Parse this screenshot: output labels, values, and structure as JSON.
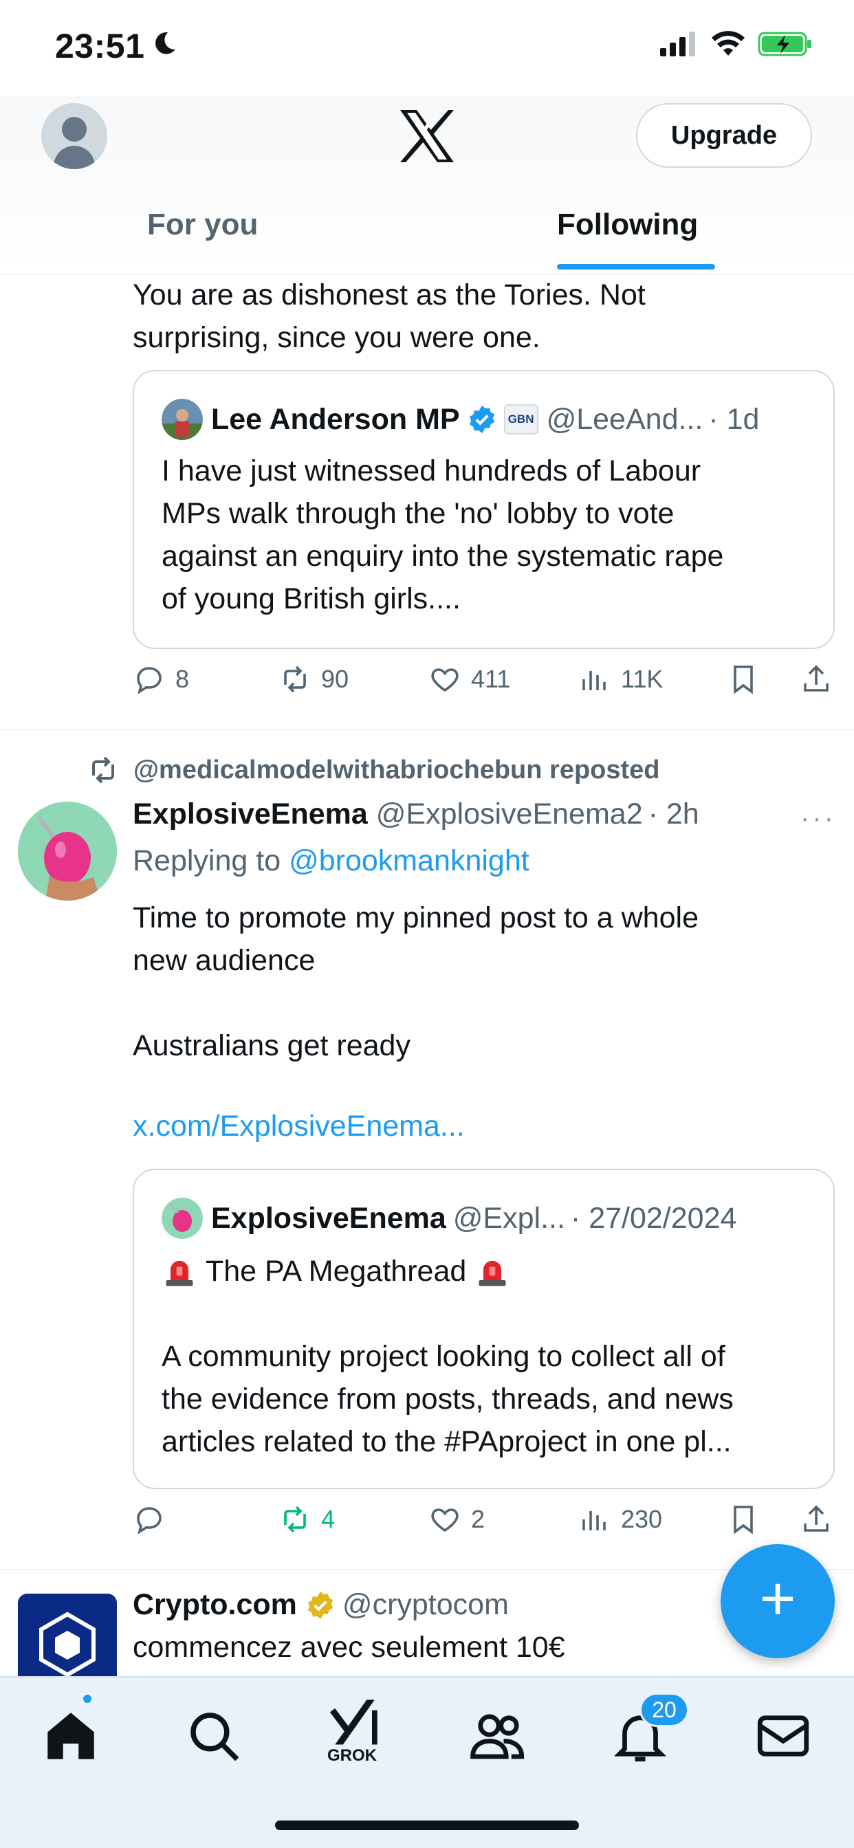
{
  "status_bar": {
    "time": "23:51"
  },
  "header": {
    "upgrade_label": "Upgrade"
  },
  "tabs": [
    {
      "label": "For you"
    },
    {
      "label": "Following"
    }
  ],
  "tweet1": {
    "text_lines": [
      "You are as dishonest as the Tories. Not",
      "surprising, since you were one."
    ],
    "quote": {
      "name": "Lee Anderson MP",
      "badge_text": "GBN",
      "handle": "@LeeAnd...",
      "time": "· 1d",
      "text_lines": [
        "I have just witnessed hundreds of Labour",
        "MPs walk through the 'no' lobby to vote",
        "against an enquiry into the systematic rape",
        "of young British girls...."
      ]
    },
    "actions": {
      "replies": "8",
      "reposts": "90",
      "likes": "411",
      "views": "11K"
    }
  },
  "tweet2": {
    "reposted_by": "@medicalmodelwithabriochebun reposted",
    "name": "ExplosiveEnema",
    "handle": "@ExplosiveEnema2",
    "time": "· 2h",
    "more": "···",
    "replying_prefix": "Replying to",
    "replying_to": "@brookmanknight",
    "body_lines": [
      "Time to promote my pinned post to a whole",
      "new audience",
      "",
      "Australians get ready"
    ],
    "link": "x.com/ExplosiveEnema...",
    "quote": {
      "name": "ExplosiveEnema",
      "handle": "@Expl...",
      "time": "· 27/02/2024",
      "title": "The PA Megathread",
      "text_lines": [
        "A community project looking to collect all of",
        "the evidence from posts, threads, and news",
        "articles related to the #PAproject in one pl..."
      ]
    },
    "actions": {
      "replies": "",
      "reposts": "4",
      "likes": "2",
      "views": "230"
    }
  },
  "tweet3": {
    "name": "Crypto.com",
    "handle": "@cryptocom",
    "text": "commencez avec seulement 10€"
  },
  "tabbar": {
    "grok_label": "GROK",
    "notifications_count": "20"
  },
  "colors": {
    "accent": "#1d9bf0",
    "repost_active": "#00ba7c",
    "text": "#0f1419",
    "muted": "#536471"
  }
}
